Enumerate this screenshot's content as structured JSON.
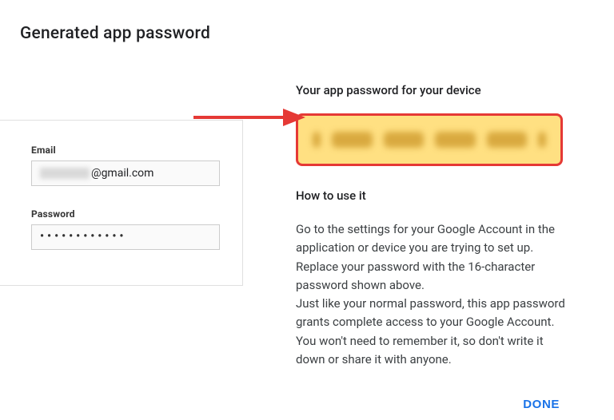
{
  "title": "Generated app password",
  "left": {
    "email_label": "Email",
    "email_suffix": "@gmail.com",
    "password_label": "Password",
    "password_masked": "••••••••••••"
  },
  "right": {
    "subhead": "Your app password for your device",
    "howto_heading": "How to use it",
    "instructions_1": "Go to the settings for your Google Account in the application or device you are trying to set up. Replace your password with the 16-character password shown above.",
    "instructions_2": "Just like your normal password, this app password grants complete access to your Google Account. You won't need to remember it, so don't write it down or share it with anyone.",
    "done_label": "DONE"
  }
}
